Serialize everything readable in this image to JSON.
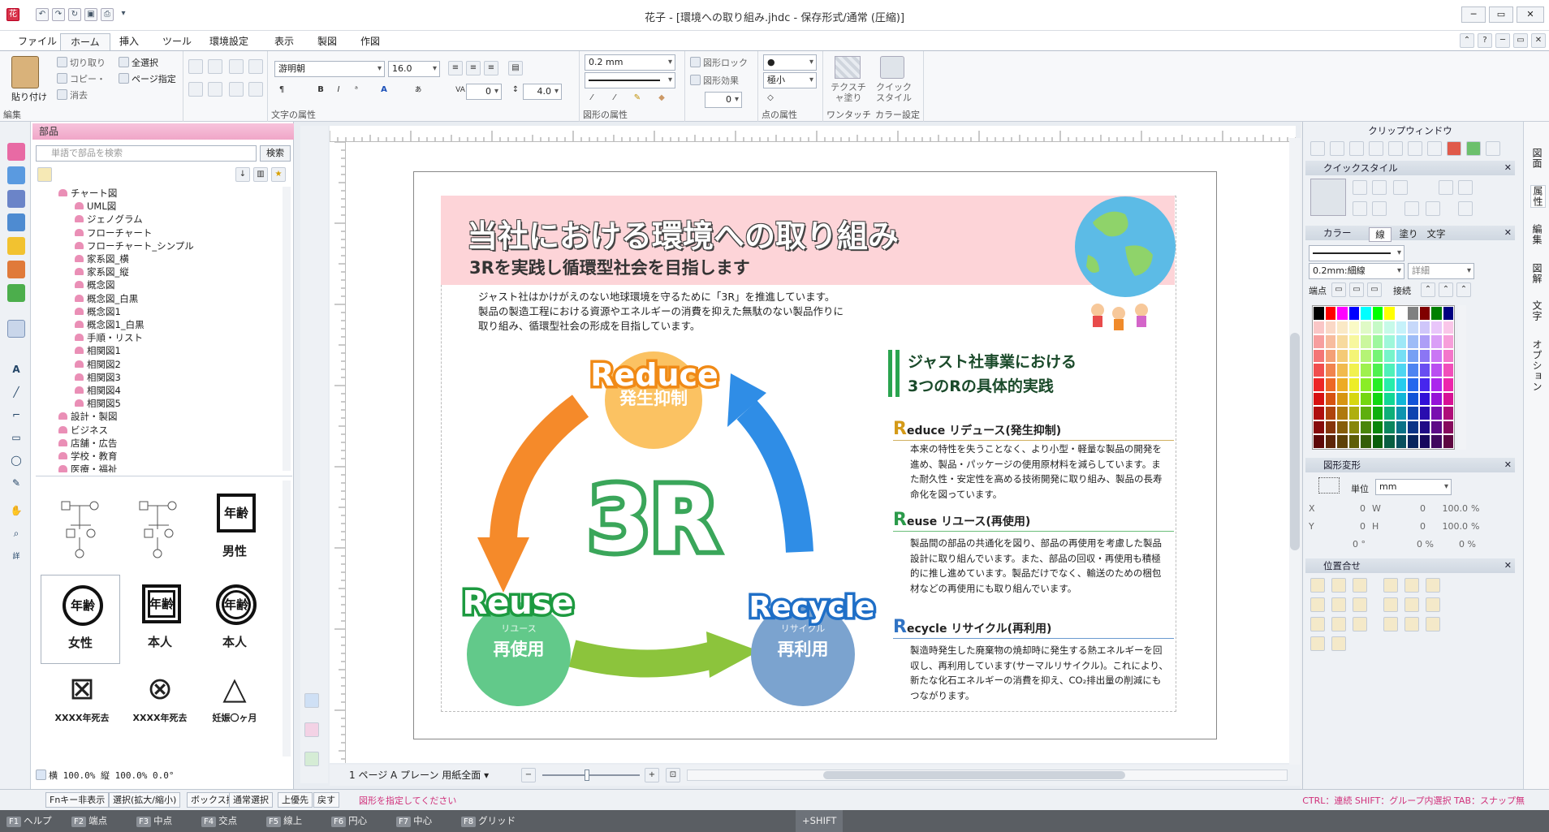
{
  "window": {
    "title": "花子 - [環境への取り組み.jhdc - 保存形式/通常 (圧縮)]",
    "minimize": "─",
    "maximize": "▭",
    "close": "✕"
  },
  "menu": {
    "tabs": [
      "ファイル",
      "ホーム",
      "挿入",
      "ツール",
      "環境設定",
      "表示",
      "製図",
      "作図"
    ],
    "active": 1
  },
  "ribbon": {
    "paste": "貼り付け",
    "cut": "切り取り",
    "copy": "コピー・",
    "erase": "消去",
    "select_all": "全選択",
    "page_select": "ページ指定",
    "group_edit": "編集",
    "font_name": "游明朝",
    "font_size": "16.0",
    "char_spacing": "0",
    "line_spacing": "4.0",
    "group_text": "文字の属性",
    "line_width": "0.2 mm",
    "group_shape": "図形の属性",
    "shape_lock": "図形ロック",
    "shape_effect": "図形効果",
    "shape_num": "0",
    "point_shape": "●",
    "point_size": "極小",
    "group_point": "点の属性",
    "texture_fill": "テクスチャ塗り",
    "quick_style": "クイックスタイル",
    "group_onetouch": "ワンタッチ",
    "group_color": "カラー設定"
  },
  "parts_panel": {
    "title": "部品",
    "search_placeholder": "単語で部品を検索",
    "search_button": "検索",
    "tree": [
      {
        "label": "チャート図",
        "level": 1
      },
      {
        "label": "UML図",
        "level": 2
      },
      {
        "label": "ジェノグラム",
        "level": 2
      },
      {
        "label": "フローチャート",
        "level": 2
      },
      {
        "label": "フローチャート_シンプル",
        "level": 2
      },
      {
        "label": "家系図_横",
        "level": 2
      },
      {
        "label": "家系図_縦",
        "level": 2
      },
      {
        "label": "概念図",
        "level": 2
      },
      {
        "label": "概念図_白黒",
        "level": 2
      },
      {
        "label": "概念図1",
        "level": 2
      },
      {
        "label": "概念図1_白黒",
        "level": 2
      },
      {
        "label": "手順・リスト",
        "level": 2
      },
      {
        "label": "相関図1",
        "level": 2
      },
      {
        "label": "相関図2",
        "level": 2
      },
      {
        "label": "相関図3",
        "level": 2
      },
      {
        "label": "相関図4",
        "level": 2
      },
      {
        "label": "相関図5",
        "level": 2
      },
      {
        "label": "設計・製図",
        "level": 1
      },
      {
        "label": "ビジネス",
        "level": 1
      },
      {
        "label": "店舗・広告",
        "level": 1
      },
      {
        "label": "学校・教育",
        "level": 1
      },
      {
        "label": "医療・福祉",
        "level": 1
      }
    ],
    "thumbnails": [
      {
        "glyph": "",
        "label": ""
      },
      {
        "glyph": "",
        "label": ""
      },
      {
        "glyph": "年齢",
        "label": "男性"
      },
      {
        "glyph": "年齢",
        "label": "女性"
      },
      {
        "glyph": "年齢",
        "label": "本人"
      },
      {
        "glyph": "年齢",
        "label": "本人"
      },
      {
        "glyph": "⊠",
        "label": "XXXX年死去"
      },
      {
        "glyph": "⊗",
        "label": "XXXX年死去"
      },
      {
        "glyph": "△",
        "label": "妊娠〇ヶ月"
      }
    ],
    "scale_text": "横 100.0% 縦 100.0%   0.0°"
  },
  "document": {
    "title": "当社における環境への取り組み",
    "subtitle": "3Rを実践し循環型社会を目指します",
    "intro": "ジャスト社はかけがえのない地球環境を守るために「3R」を推進しています。\n製品の製造工程における資源やエネルギーの消費を抑えた無駄のない製品作りに\n取り組み、循環型社会の形成を目指しています。",
    "center_logo": "3R",
    "reduce": {
      "en": "Reduce",
      "kana": "リデュース",
      "jp": "発生抑制"
    },
    "reuse": {
      "en": "Reuse",
      "kana": "リユース",
      "jp": "再使用"
    },
    "recycle": {
      "en": "Recycle",
      "kana": "リサイクル",
      "jp": "再利用"
    },
    "side_title_1": "ジャスト社事業における",
    "side_title_2": "3つのRの具体的実践",
    "reduce_head_letter": "R",
    "reduce_head": "educe リデュース(発生抑制)",
    "reduce_body": "本来の特性を失うことなく、より小型・軽量な製品の開発を進め、製品・パッケージの使用原材料を減らしています。また耐久性・安定性を高める技術開発に取り組み、製品の長寿命化を図っています。",
    "reuse_head_letter": "R",
    "reuse_head": "euse リユース(再使用)",
    "reuse_body": "製品間の部品の共通化を図り、部品の再使用を考慮した製品設計に取り組んでいます。また、部品の回収・再使用も積極的に推し進めています。製品だけでなく、輸送のための梱包材などの再使用にも取り組んでいます。",
    "recycle_head_letter": "R",
    "recycle_head": "ecycle リサイクル(再利用)",
    "recycle_body": "製造時発生した廃棄物の焼却時に発生する熱エネルギーを回収し、再利用しています(サーマルリサイクル)。これにより、新たな化石エネルギーの消費を抑え、CO₂排出量の削減にもつながります。"
  },
  "page_nav": {
    "text": "1 ページ A プレーン 用紙全面 ▾"
  },
  "right_panel": {
    "clip_title": "クリップウィンドウ",
    "quick_style_title": "クイックスタイル",
    "color_title": "カラー",
    "color_tabs": [
      "線",
      "塗り",
      "文字"
    ],
    "line_combo": "0.2mm:細線",
    "detail": "詳細",
    "endpoint": "端点",
    "join": "接続",
    "transform_title": "図形変形",
    "unit_label": "単位",
    "unit": "mm",
    "x": "0",
    "w": "0",
    "y": "0",
    "h": "0",
    "xpct": "100.0",
    "ypct": "100.0",
    "angle": "0 °",
    "pct1": "0 %",
    "pct2": "0 %",
    "align_title": "位置合せ",
    "side_tabs": [
      "図面",
      "属性",
      "編集",
      "図解",
      "文字",
      "オプション"
    ]
  },
  "status": {
    "buttons": [
      "Fnキー非表示",
      "選択(拡大/縮小)",
      "ボックス掛",
      "通常選択",
      "上優先",
      "戻す"
    ],
    "message": "図形を指定してください",
    "hint": "CTRL：連続 SHIFT：グループ内選択 TAB：スナップ無"
  },
  "fkeys": [
    {
      "key": "F1",
      "label": "ヘルプ"
    },
    {
      "key": "F2",
      "label": "端点"
    },
    {
      "key": "F3",
      "label": "中点"
    },
    {
      "key": "F4",
      "label": "交点"
    },
    {
      "key": "F5",
      "label": "線上"
    },
    {
      "key": "F6",
      "label": "円心"
    },
    {
      "key": "F7",
      "label": "中心"
    },
    {
      "key": "F8",
      "label": "グリッド"
    }
  ],
  "shift_label": "+SHIFT",
  "colors": {
    "reduce": "#f4a53a",
    "reuse": "#3fb35f",
    "recycle": "#2f7fd0",
    "accent_pink": "#f0a6c8"
  }
}
